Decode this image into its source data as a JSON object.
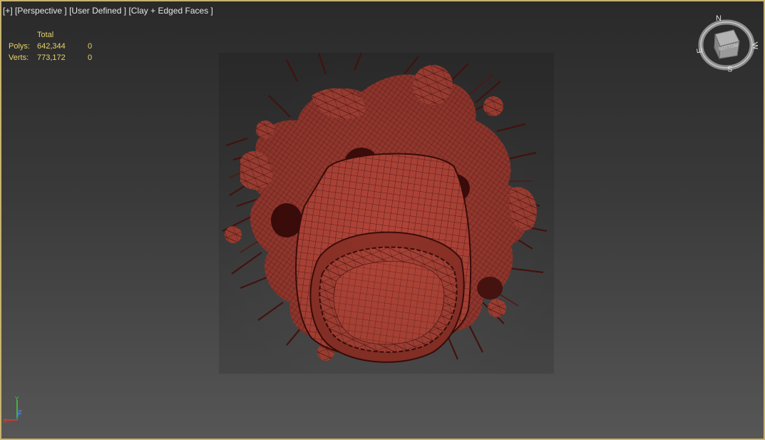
{
  "viewport": {
    "label_parts": [
      "[+]",
      "[Perspective ]",
      "[User Defined ]",
      "[Clay + Edged Faces ]"
    ]
  },
  "stats": {
    "header": "Total",
    "rows": [
      {
        "label": "Polys:",
        "total": "642,344",
        "selected": "0"
      },
      {
        "label": "Verts:",
        "total": "773,172",
        "selected": "0"
      }
    ]
  },
  "viewcube": {
    "face_label": "BOTTOM",
    "compass": {
      "n": "N",
      "e": "E",
      "s": "S",
      "w": "W"
    }
  },
  "axis": {
    "x": "X",
    "y": "Y",
    "z": "Z"
  },
  "colors": {
    "stats_text": "#e8d36a",
    "border": "#c8b46e",
    "model": "#b8463a",
    "model_dark": "#3d0c0a"
  }
}
